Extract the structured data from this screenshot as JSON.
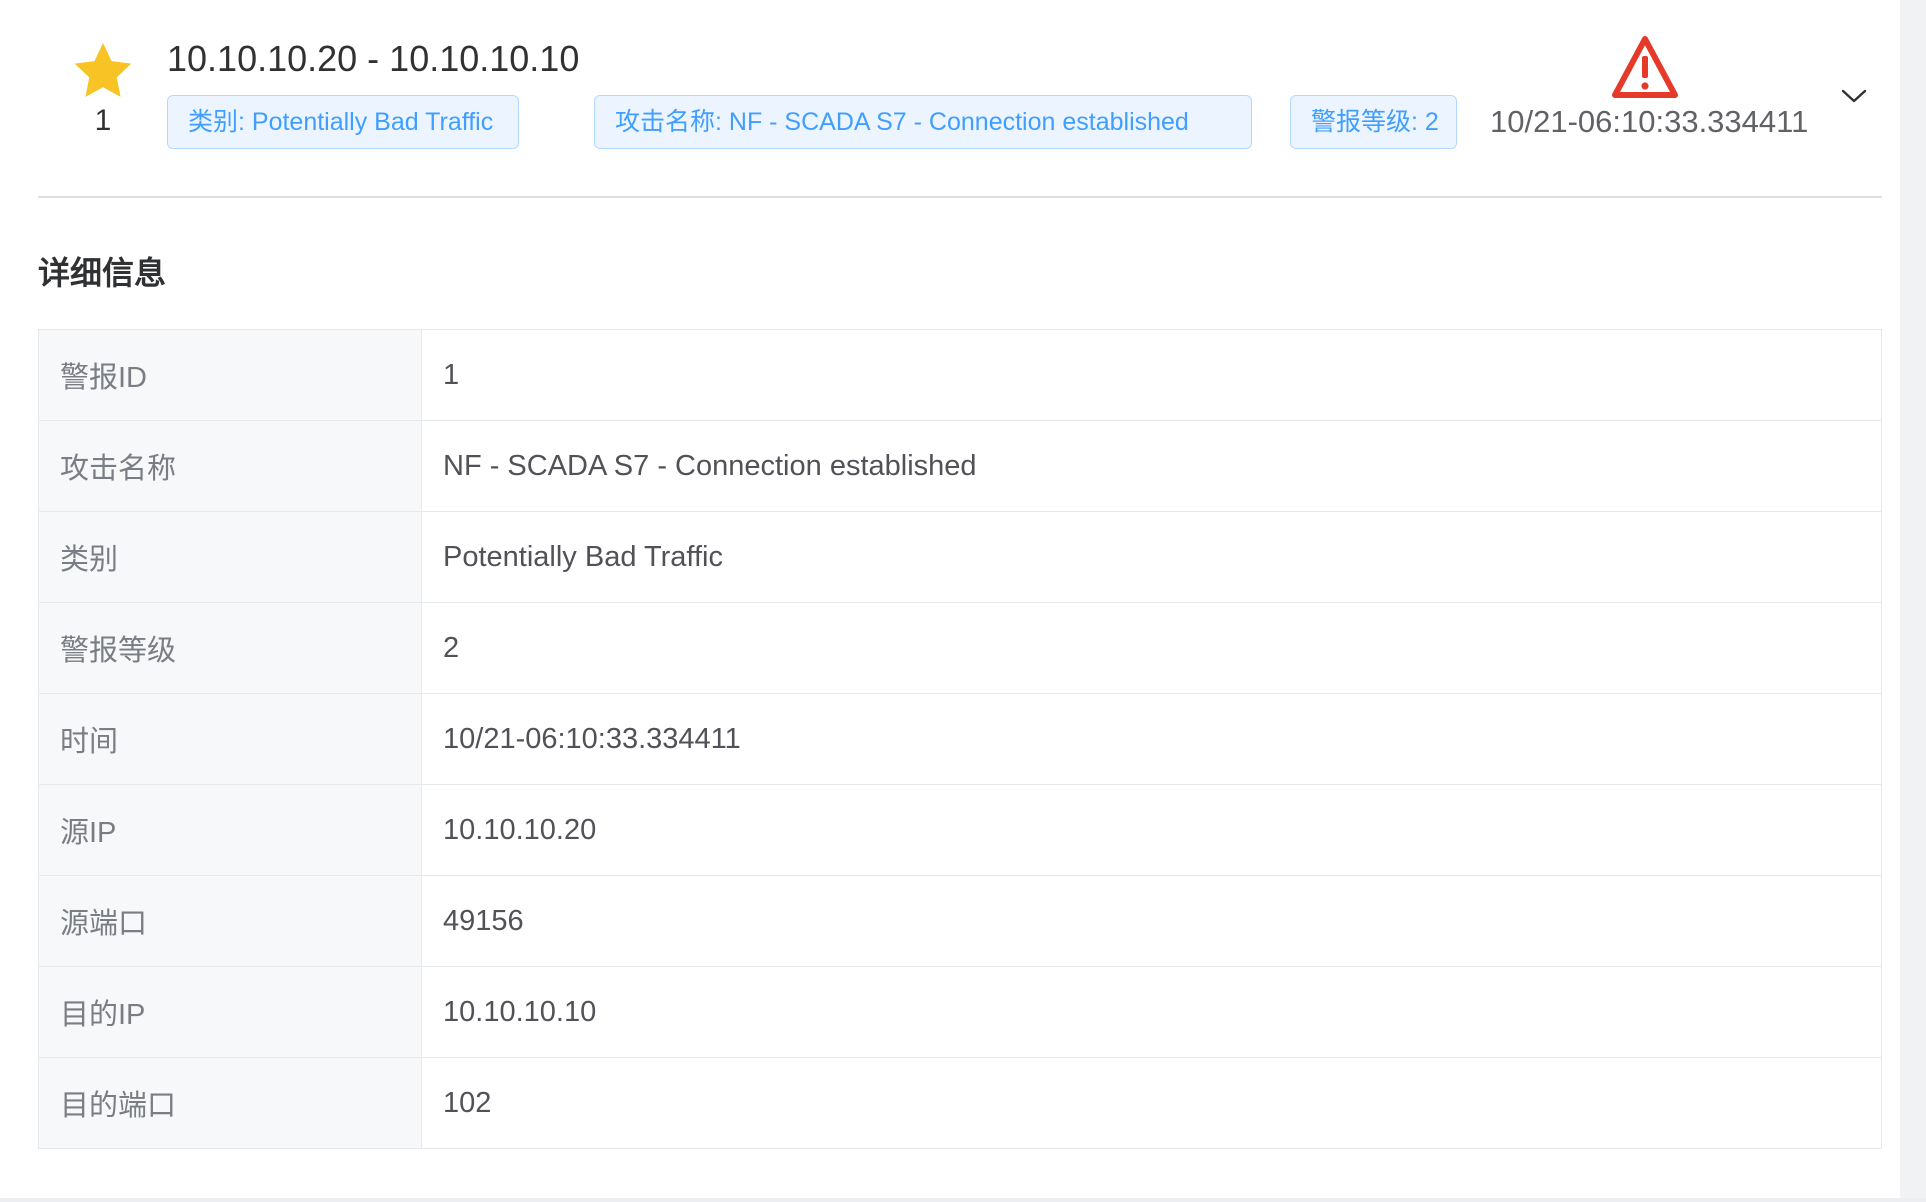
{
  "alert": {
    "rank": "1",
    "ip_pair": "10.10.10.20 - 10.10.10.10",
    "tags": {
      "category": "类别: Potentially Bad Traffic",
      "attack_name": "攻击名称: NF - SCADA S7 - Connection established",
      "level": "警报等级: 2"
    },
    "timestamp": "10/21-06:10:33.334411",
    "icons": {
      "favorite": "star-icon",
      "severity": "warning-triangle-icon",
      "expand": "chevron-down-icon"
    },
    "colors": {
      "star": "#f7c325",
      "warning": "#e5392a",
      "tag_text": "#409eff",
      "tag_bg": "#ecf5ff",
      "tag_border": "#b3d8ff"
    }
  },
  "details": {
    "title": "详细信息",
    "rows": [
      {
        "label": "警报ID",
        "value": "1"
      },
      {
        "label": "攻击名称",
        "value": "NF - SCADA S7 - Connection established"
      },
      {
        "label": "类别",
        "value": "Potentially Bad Traffic"
      },
      {
        "label": "警报等级",
        "value": "2"
      },
      {
        "label": "时间",
        "value": "10/21-06:10:33.334411"
      },
      {
        "label": "源IP",
        "value": "10.10.10.20"
      },
      {
        "label": "源端口",
        "value": "49156"
      },
      {
        "label": "目的IP",
        "value": "10.10.10.10"
      },
      {
        "label": "目的端口",
        "value": "102"
      }
    ]
  }
}
